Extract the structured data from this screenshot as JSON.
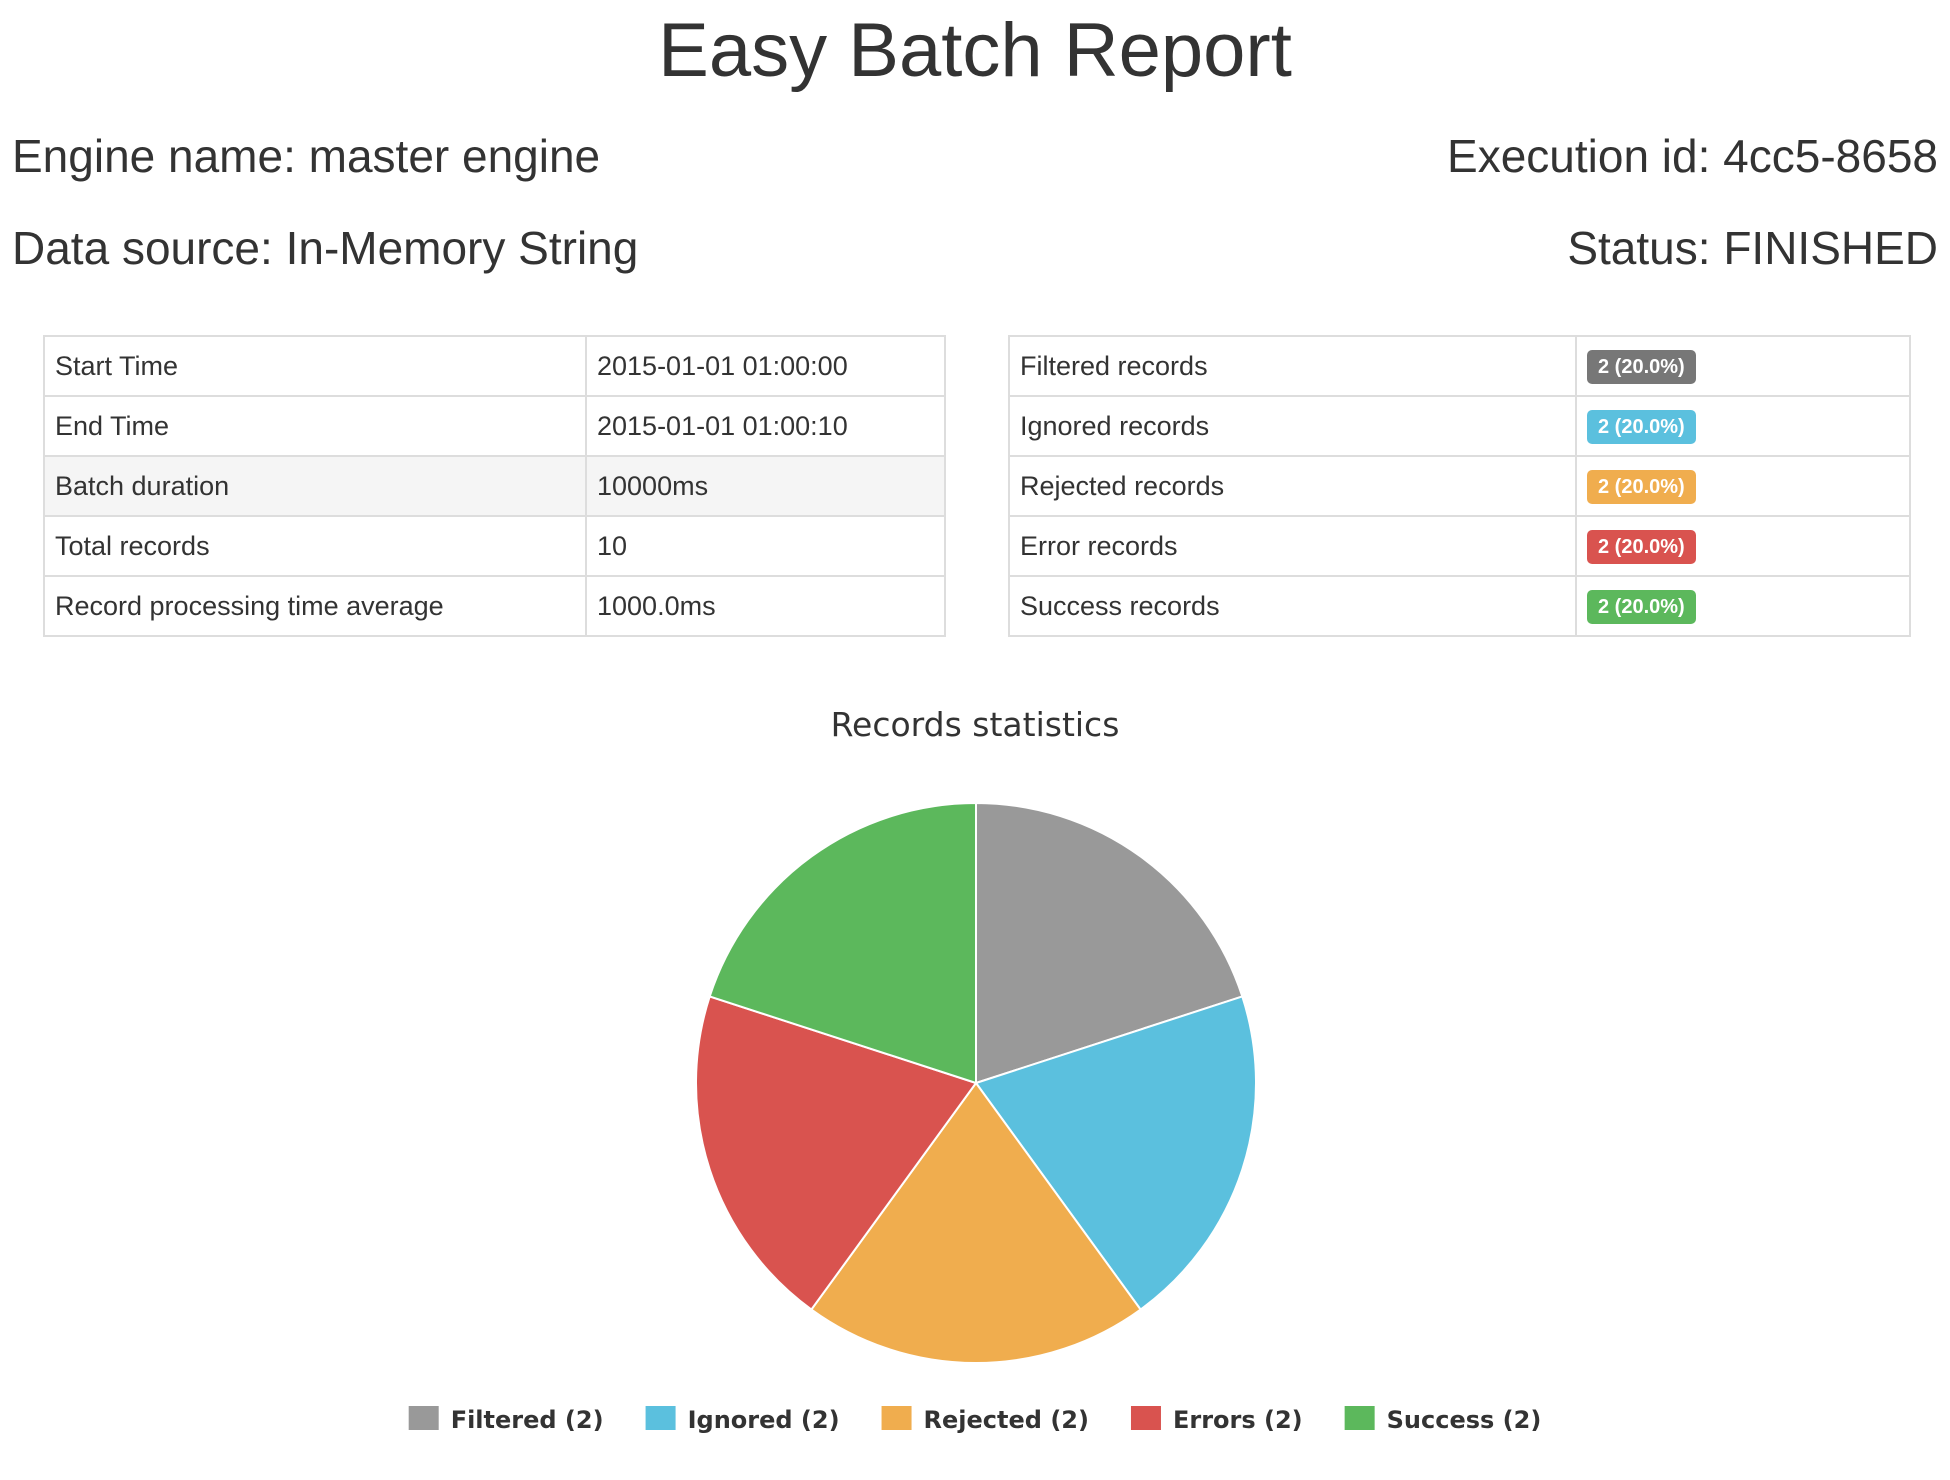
{
  "header": {
    "title": "Easy Batch Report",
    "engine_name": "Engine name: master engine",
    "execution_id": "Execution id: 4cc5-8658",
    "data_source": "Data source: In-Memory String",
    "status": "Status: FINISHED"
  },
  "timing_table": {
    "rows": [
      {
        "label": "Start Time",
        "value": "2015-01-01 01:00:00"
      },
      {
        "label": "End Time",
        "value": "2015-01-01 01:00:10"
      },
      {
        "label": "Batch duration",
        "value": "10000ms"
      },
      {
        "label": "Total records",
        "value": "10"
      },
      {
        "label": "Record processing time average",
        "value": "1000.0ms"
      }
    ]
  },
  "records_table": {
    "rows": [
      {
        "label": "Filtered records",
        "badge": "2 (20.0%)",
        "color": "#777777"
      },
      {
        "label": "Ignored records",
        "badge": "2 (20.0%)",
        "color": "#5bc0de"
      },
      {
        "label": "Rejected records",
        "badge": "2 (20.0%)",
        "color": "#f0ad4e"
      },
      {
        "label": "Error records",
        "badge": "2 (20.0%)",
        "color": "#d9534f"
      },
      {
        "label": "Success records",
        "badge": "2 (20.0%)",
        "color": "#5cb85c"
      }
    ]
  },
  "chart_data": {
    "type": "pie",
    "title": "Records statistics",
    "categories": [
      "Filtered",
      "Ignored",
      "Rejected",
      "Errors",
      "Success"
    ],
    "values": [
      2,
      2,
      2,
      2,
      2
    ],
    "legend_labels": [
      "Filtered (2)",
      "Ignored (2)",
      "Rejected (2)",
      "Errors (2)",
      "Success (2)"
    ],
    "colors": [
      "#999999",
      "#5bc0de",
      "#f0ad4e",
      "#d9534f",
      "#5cb85c"
    ],
    "legend_position": "bottom"
  }
}
